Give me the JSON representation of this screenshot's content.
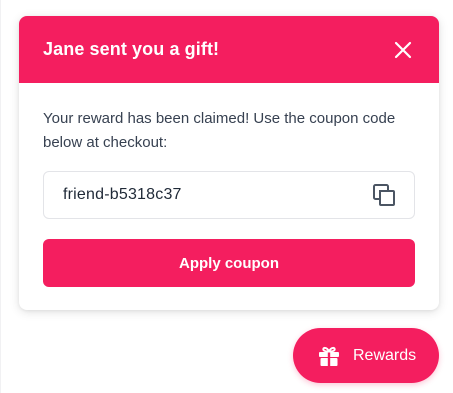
{
  "modal": {
    "title": "Jane sent you a gift!",
    "message": "Your reward has been claimed! Use the coupon code below at checkout:",
    "coupon_code": "friend-b5318c37",
    "apply_label": "Apply coupon",
    "close_icon": "close-icon",
    "copy_icon": "copy-icon"
  },
  "launcher": {
    "label": "Rewards",
    "icon": "gift-icon"
  },
  "colors": {
    "accent": "#f41e5f",
    "text": "#374151",
    "border": "#e3e4e8"
  }
}
